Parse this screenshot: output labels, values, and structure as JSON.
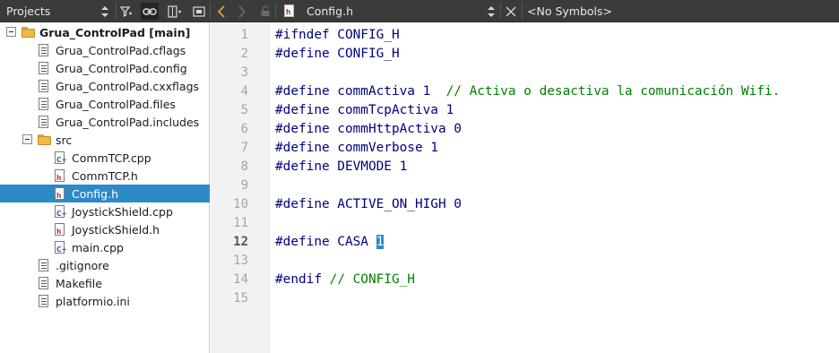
{
  "toolbar": {
    "panel_title": "Projects",
    "icons": [
      "sort-updown-icon",
      "filter-icon",
      "link-icon",
      "split-icon",
      "close-pane-icon",
      "back-icon",
      "forward-icon",
      "lock-icon",
      "close-doc-icon"
    ],
    "open_file": "Config.h",
    "symbols": "<No Symbols>"
  },
  "project_tree": [
    {
      "label": "Grua_ControlPad [main]",
      "kind": "project",
      "level": 0
    },
    {
      "label": "Grua_ControlPad.cflags",
      "kind": "file",
      "level": 1
    },
    {
      "label": "Grua_ControlPad.config",
      "kind": "file",
      "level": 1
    },
    {
      "label": "Grua_ControlPad.cxxflags",
      "kind": "file",
      "level": 1
    },
    {
      "label": "Grua_ControlPad.files",
      "kind": "file",
      "level": 1
    },
    {
      "label": "Grua_ControlPad.includes",
      "kind": "file",
      "level": 1
    },
    {
      "label": "src",
      "kind": "folder",
      "level": 1
    },
    {
      "label": "CommTCP.cpp",
      "kind": "cpp",
      "level": 2
    },
    {
      "label": "CommTCP.h",
      "kind": "h",
      "level": 2
    },
    {
      "label": "Config.h",
      "kind": "h",
      "level": 2,
      "selected": true
    },
    {
      "label": "JoystickShield.cpp",
      "kind": "cpp",
      "level": 2
    },
    {
      "label": "JoystickShield.h",
      "kind": "h",
      "level": 2
    },
    {
      "label": "main.cpp",
      "kind": "cpp",
      "level": 2
    },
    {
      "label": ".gitignore",
      "kind": "file",
      "level": 1
    },
    {
      "label": "Makefile",
      "kind": "file",
      "level": 1
    },
    {
      "label": "platformio.ini",
      "kind": "file",
      "level": 1
    }
  ],
  "editor": {
    "current_line": 12,
    "lines": [
      {
        "num": "1",
        "pp": "#ifndef CONFIG_H",
        "rest": "",
        "comment": ""
      },
      {
        "num": "2",
        "pp": "#define CONFIG_H",
        "rest": "",
        "comment": ""
      },
      {
        "num": "3",
        "pp": "",
        "rest": "",
        "comment": ""
      },
      {
        "num": "4",
        "pp": "#define commActiva 1  ",
        "rest": "",
        "comment": "// Activa o desactiva la comunicación Wifi."
      },
      {
        "num": "5",
        "pp": "#define commTcpActiva 1",
        "rest": "",
        "comment": ""
      },
      {
        "num": "6",
        "pp": "#define commHttpActiva 0",
        "rest": "",
        "comment": ""
      },
      {
        "num": "7",
        "pp": "#define commVerbose 1",
        "rest": "",
        "comment": ""
      },
      {
        "num": "8",
        "pp": "#define DEVMODE 1",
        "rest": "",
        "comment": ""
      },
      {
        "num": "9",
        "pp": "",
        "rest": "",
        "comment": ""
      },
      {
        "num": "10",
        "pp": "#define ACTIVE_ON_HIGH 0",
        "rest": "",
        "comment": ""
      },
      {
        "num": "11",
        "pp": "",
        "rest": "",
        "comment": ""
      },
      {
        "num": "12",
        "pp": "#define CASA ",
        "rest": "1",
        "comment": ""
      },
      {
        "num": "13",
        "pp": "",
        "rest": "",
        "comment": ""
      },
      {
        "num": "14",
        "pp": "#endif ",
        "rest": "",
        "comment": "// CONFIG_H"
      },
      {
        "num": "15",
        "pp": "",
        "rest": "",
        "comment": ""
      }
    ]
  },
  "colors": {
    "toolbar_bg": "#3b3b3b",
    "selection": "#2d8ac8",
    "preprocessor": "#000080",
    "comment": "#008000",
    "gutter_bg": "#f2f2f2"
  }
}
